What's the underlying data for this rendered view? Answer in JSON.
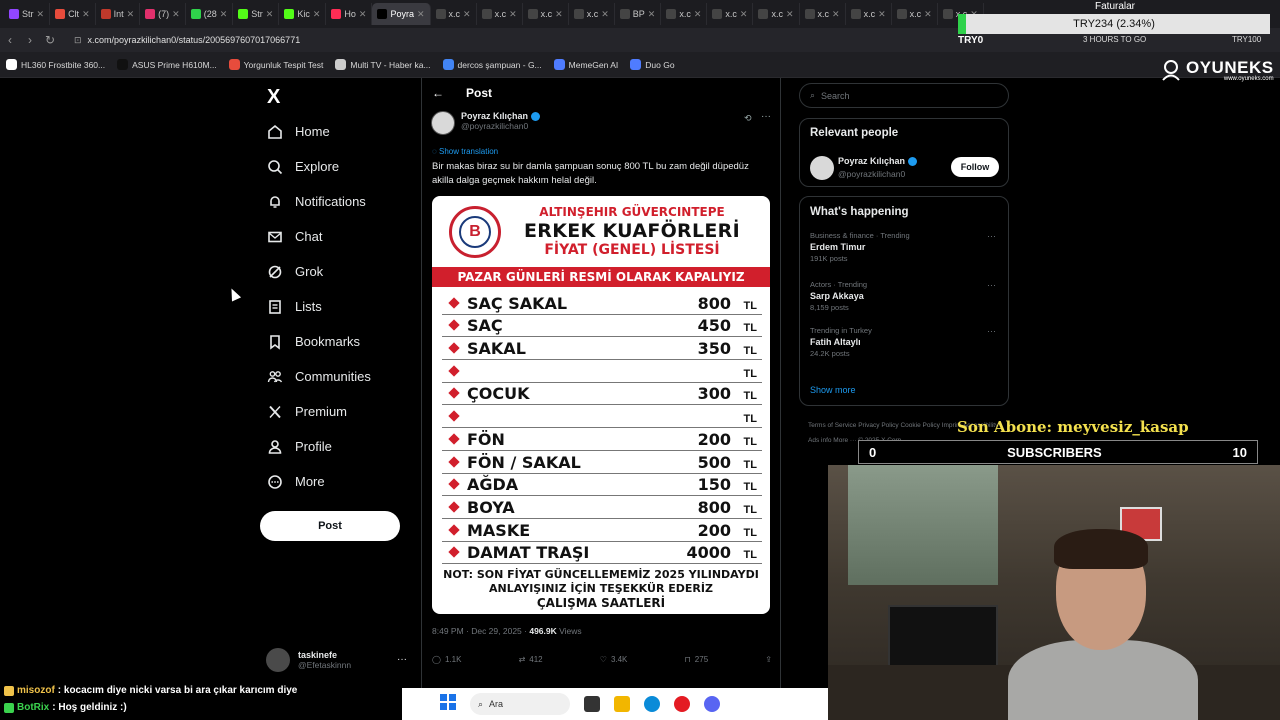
{
  "browser": {
    "tabs": [
      {
        "label": "Str",
        "color": "#9146ff"
      },
      {
        "label": "Clt",
        "color": "#e74c3c"
      },
      {
        "label": "Int",
        "color": "#c0392b"
      },
      {
        "label": "(7)",
        "color": "#e1306c"
      },
      {
        "label": "(28",
        "color": "#2fd24b"
      },
      {
        "label": "Str",
        "color": "#53fc18"
      },
      {
        "label": "Kic",
        "color": "#53fc18"
      },
      {
        "label": "Ho",
        "color": "#ff2d55"
      },
      {
        "label": "Poyra",
        "color": "#000000",
        "active": true
      },
      {
        "label": "x.c",
        "color": "#444444"
      },
      {
        "label": "x.c",
        "color": "#444444"
      },
      {
        "label": "x.c",
        "color": "#444444"
      },
      {
        "label": "x.c",
        "color": "#444444"
      },
      {
        "label": "BP",
        "color": "#444444"
      },
      {
        "label": "x.c",
        "color": "#444444"
      },
      {
        "label": "x.c",
        "color": "#444444"
      },
      {
        "label": "x.c",
        "color": "#444444"
      },
      {
        "label": "x.c",
        "color": "#444444"
      },
      {
        "label": "x.c",
        "color": "#444444"
      },
      {
        "label": "x.c",
        "color": "#444444"
      },
      {
        "label": "x.c",
        "color": "#444444"
      }
    ],
    "url": "x.com/poyrazkilichan0/status/2005697607017066771",
    "bookmarks": [
      {
        "label": "HL360 Frostbite 360...",
        "color": "#ffffff"
      },
      {
        "label": "ASUS Prime H610M...",
        "color": "#111111"
      },
      {
        "label": "Yorgunluk Tespit Test",
        "color": "#e74c3c"
      },
      {
        "label": "Multi TV - Haber ka...",
        "color": "#cccccc"
      },
      {
        "label": "dercos şampuan - G...",
        "color": "#4285f4"
      },
      {
        "label": "MemeGen AI",
        "color": "#4f7cff"
      },
      {
        "label": "Duo Go",
        "color": "#4f7cff"
      }
    ]
  },
  "overlay_top": {
    "faturalar": "Faturalar",
    "ticker": "TRY234 (2.34%)",
    "try0": "TRY0",
    "hours": "3 HOURS TO GO",
    "try100": "TRY100",
    "brand": "OYUNEKS",
    "brand_url": "www.oyuneks.com"
  },
  "nav": {
    "logo": "X",
    "items": [
      {
        "label": "Home",
        "icon": "home-icon"
      },
      {
        "label": "Explore",
        "icon": "search-icon"
      },
      {
        "label": "Notifications",
        "icon": "bell-icon"
      },
      {
        "label": "Chat",
        "icon": "mail-icon"
      },
      {
        "label": "Grok",
        "icon": "grok-icon"
      },
      {
        "label": "Lists",
        "icon": "list-icon"
      },
      {
        "label": "Bookmarks",
        "icon": "bookmark-icon"
      },
      {
        "label": "Communities",
        "icon": "people-icon"
      },
      {
        "label": "Premium",
        "icon": "x-icon"
      },
      {
        "label": "Profile",
        "icon": "person-icon"
      },
      {
        "label": "More",
        "icon": "more-circle-icon"
      }
    ],
    "post_button": "Post",
    "account": {
      "name": "taskinefe",
      "handle": "@Efetaskinnn"
    }
  },
  "post": {
    "header": "Post",
    "author_name": "Poyraz Kılıçhan",
    "author_handle": "@poyrazkilichan0",
    "show_translation": "Show translation",
    "text": "Bir makas biraz su bir damla şampuan sonuç 800 TL bu zam değil düpedüz akilla dalga geçmek hakkım helal değil.",
    "image": {
      "subtitle": "ALTINŞEHIR GÜVERCINTEPE",
      "title": "ERKEK KUAFÖRLERİ",
      "title2": "FİYAT (GENEL) LİSTESİ",
      "banner": "PAZAR GÜNLERİ RESMİ OLARAK KAPALIYIZ",
      "currency": "TL",
      "rows": [
        {
          "service": "SAÇ SAKAL",
          "price": "800"
        },
        {
          "service": "SAÇ",
          "price": "450"
        },
        {
          "service": "SAKAL",
          "price": "350"
        },
        {
          "service": "",
          "price": ""
        },
        {
          "service": "ÇOCUK",
          "price": "300"
        },
        {
          "service": "",
          "price": ""
        },
        {
          "service": "FÖN",
          "price": "200"
        },
        {
          "service": "FÖN / SAKAL",
          "price": "500"
        },
        {
          "service": "AĞDA",
          "price": "150"
        },
        {
          "service": "BOYA",
          "price": "800"
        },
        {
          "service": "MASKE",
          "price": "200"
        },
        {
          "service": "DAMAT TRAŞI",
          "price": "4000"
        }
      ],
      "note1": "NOT: SON FİYAT GÜNCELLEMEMİZ 2025 YILINDAYDI",
      "note2": "ANLAYIŞINIZ İÇİN TEŞEKKÜR EDERİZ",
      "note3": "ÇALIŞMA SAATLERİ"
    },
    "timestamp": "8:49 PM · Dec 29, 2025 ·",
    "views": "496.9K",
    "views_label": "Views",
    "replies": "1.1K",
    "reposts": "412",
    "likes": "3.4K",
    "bookmarks": "275"
  },
  "right": {
    "search_placeholder": "Search",
    "relevant_title": "Relevant people",
    "relevant_name": "Poyraz Kılıçhan",
    "relevant_handle": "@poyrazkilichan0",
    "follow": "Follow",
    "happening_title": "What's happening",
    "trends": [
      {
        "context": "Business & finance · Trending",
        "title": "Erdem Timur",
        "posts": "191K posts"
      },
      {
        "context": "Actors · Trending",
        "title": "Sarp Akkaya",
        "posts": "8,159 posts"
      },
      {
        "context": "Trending in Turkey",
        "title": "Fatih Altaylı",
        "posts": "24.2K posts"
      }
    ],
    "show_more": "Show more",
    "footer": "Terms of Service   Privacy Policy   Cookie Policy   Imprint   Accessibility   Ads info   More ···   © 2025 X Corp."
  },
  "stream": {
    "son_abone": "Son Abone: meyvesiz_kasap",
    "sub_left": "0",
    "sub_label": "SUBSCRIBERS",
    "sub_right": "10",
    "chat": [
      {
        "user": "misozof",
        "message": ": kocacım diye nicki varsa bi ara çıkar karıcım diye",
        "color": "#f0c24a"
      },
      {
        "user": "BotRix",
        "message": ": Hoş geldiniz :)",
        "color": "#3bd24e"
      }
    ]
  },
  "taskbar": {
    "search": "Ara"
  }
}
